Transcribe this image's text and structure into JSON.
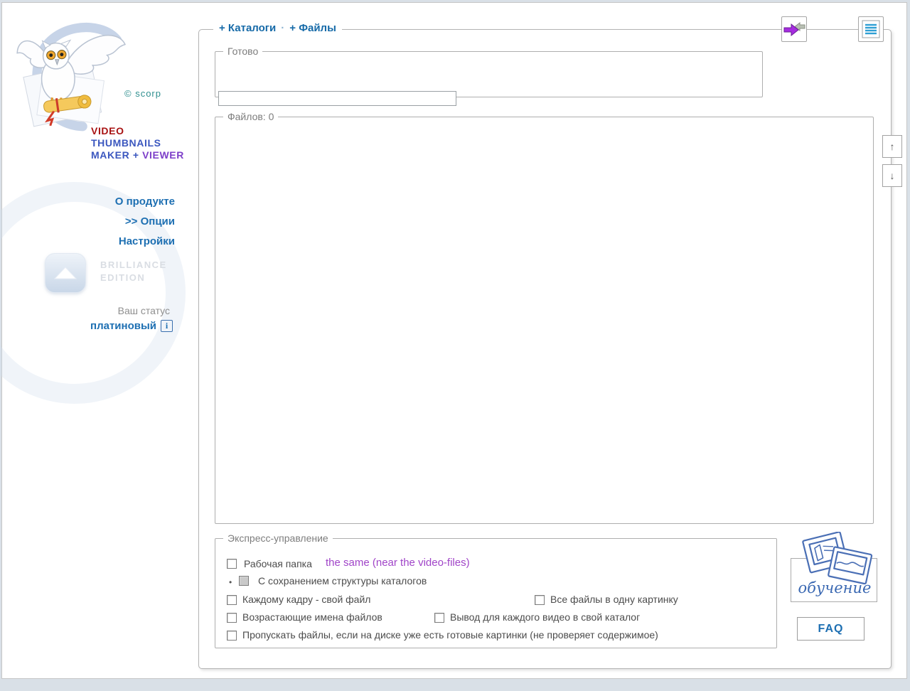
{
  "branding": {
    "copyright": "© scorp",
    "product_line1": "VIDEO",
    "product_line2": "THUMBNAILS",
    "product_line3a": "MAKER + ",
    "product_line3b": "VIEWER",
    "edition_line1": "BRILLIANCE",
    "edition_line2": "EDITION"
  },
  "sidebar": {
    "menu": [
      {
        "label": "О продукте"
      },
      {
        "label": ">> Опции"
      },
      {
        "label": "Настройки"
      }
    ],
    "status_label": "Ваш статус",
    "status_value": "платиновый",
    "info_icon_glyph": "i"
  },
  "header": {
    "add_catalogs_label": "+ Каталоги",
    "separator": "·",
    "add_files_label": "+ Файлы"
  },
  "ready_group": {
    "label": "Готово"
  },
  "files_group": {
    "label": "Файлов: 0",
    "count": 0
  },
  "list_controls": {
    "move_up_glyph": "↑",
    "move_down_glyph": "↓"
  },
  "express_group": {
    "label": "Экспресс-управление",
    "working_folder": {
      "label": "Рабочая папка",
      "checked": false,
      "value": "the same (near the video-files)"
    },
    "keep_structure": {
      "bullet": "•",
      "label": "С сохранением структуры каталогов",
      "checked": false,
      "disabled": true
    },
    "own_file_per_frame": {
      "label": "Каждому кадру - свой файл",
      "checked": false
    },
    "all_files_one_image": {
      "label": "Все файлы в одну картинку",
      "checked": false
    },
    "increasing_file_names": {
      "label": "Возрастающие имена файлов",
      "checked": false
    },
    "output_per_video_folder": {
      "label": "Вывод для каждого видео в свой каталог",
      "checked": false
    },
    "skip_existing": {
      "label": "Пропускать файлы, если на диске уже есть готовые картинки (не проверяет содержимое)",
      "checked": false
    }
  },
  "help": {
    "training_label": "обучение",
    "faq_label": "FAQ"
  },
  "colors": {
    "accent_blue": "#1d6fb2",
    "legend_gray": "#7d7d7d",
    "purple_link": "#a044c8",
    "title_red": "#a81212",
    "title_blue": "#3b57bf",
    "title_purple": "#7d3fc9",
    "copyright_teal": "#2f8f8f",
    "sketch_blue": "#3a68b2"
  }
}
